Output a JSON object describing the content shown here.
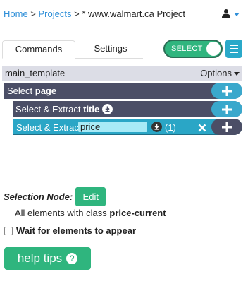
{
  "breadcrumb": {
    "home": "Home",
    "sep1": " > ",
    "projects": "Projects",
    "sep2": " > ",
    "project": "* www.walmart.ca Project"
  },
  "tabs": [
    {
      "label": "Commands",
      "active": true
    },
    {
      "label": "Settings",
      "active": false
    }
  ],
  "select_toggle": {
    "label": "SELECT",
    "on": true
  },
  "template": {
    "name": "main_template",
    "options_label": "Options"
  },
  "commands": [
    {
      "prefix": "Select",
      "name": "page",
      "has_download": false
    },
    {
      "prefix": "Select & Extract",
      "name": "title",
      "has_download": true
    },
    {
      "prefix": "Select & Extract",
      "name": "price",
      "has_download": true,
      "count": "(1)",
      "editing": true
    }
  ],
  "selection": {
    "label": "Selection Node:",
    "edit_label": "Edit",
    "desc_prefix": "All elements with class ",
    "desc_class": "price-current"
  },
  "wait": {
    "label": "Wait for elements to appear",
    "checked": false
  },
  "help": {
    "label": "help tips"
  },
  "colors": {
    "green": "#2fb57e",
    "teal": "#2aa6c6",
    "dark_row": "#4b4e66",
    "link": "#2f8fd8"
  }
}
